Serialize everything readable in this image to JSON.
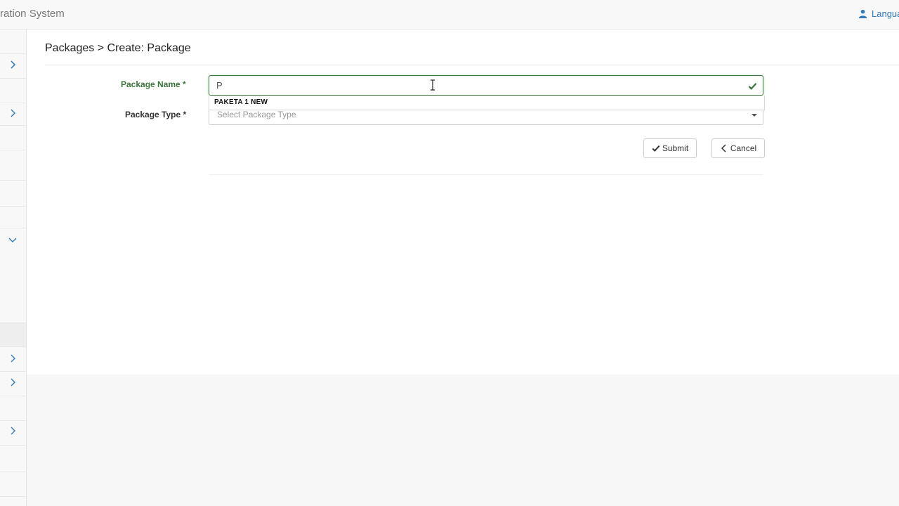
{
  "header": {
    "brand": "ration System",
    "language_label": "Langua"
  },
  "breadcrumb": "Packages > Create: Package",
  "form": {
    "package_name_label": "Package Name *",
    "package_name_value": "P",
    "autocomplete_suggestion": "PAKETA 1 NEW",
    "package_type_label": "Package Type *",
    "package_type_placeholder": "Select Package Type",
    "submit_label": "Submit",
    "cancel_label": "Cancel"
  },
  "colors": {
    "success_green": "#3c763d",
    "link_blue": "#337ab7"
  },
  "icons": {
    "language": "user-icon",
    "valid": "check-icon",
    "submit": "check-icon",
    "cancel": "chevron-left-icon",
    "sidebar": [
      "chevron-right-icon",
      "chevron-down-icon"
    ]
  }
}
